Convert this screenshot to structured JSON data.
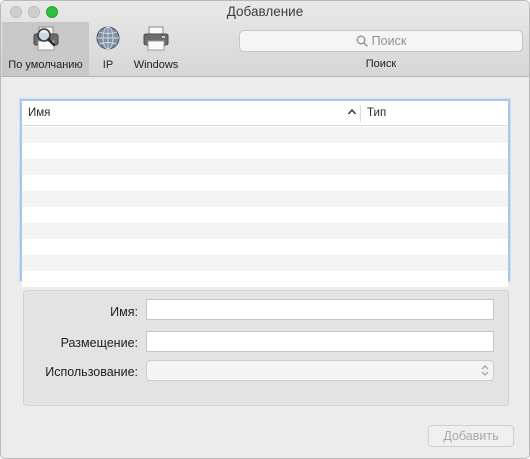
{
  "window": {
    "title": "Добавление"
  },
  "toolbar": {
    "items": [
      {
        "label": "По умолчанию",
        "icon": "printer-magnifier-icon",
        "selected": true
      },
      {
        "label": "IP",
        "icon": "globe-icon",
        "selected": false
      },
      {
        "label": "Windows",
        "icon": "printer-icon",
        "selected": false
      }
    ],
    "search": {
      "placeholder": "Поиск",
      "caption": "Поиск",
      "icon": "magnifier-icon"
    }
  },
  "table": {
    "columns": [
      {
        "label": "Имя",
        "sorted": "ascending"
      },
      {
        "label": "Тип"
      }
    ],
    "rows": []
  },
  "form": {
    "name_label": "Имя:",
    "name_value": "",
    "location_label": "Размещение:",
    "location_value": "",
    "usage_label": "Использование:",
    "usage_value": ""
  },
  "actions": {
    "add_label": "Добавить",
    "add_enabled": false
  },
  "colors": {
    "table_focus_border": "#a9c6ec",
    "zoom_button": "#2fc043",
    "selected_tab_bg": "#c8c8c8"
  }
}
